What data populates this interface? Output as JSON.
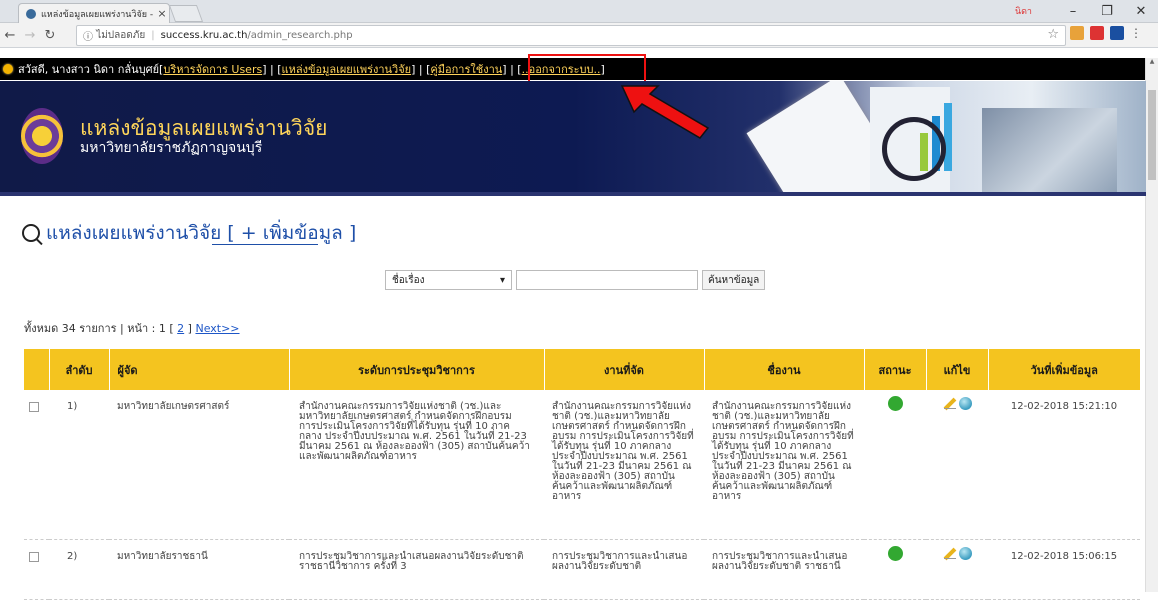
{
  "browser": {
    "tab_title": "แหล่งข้อมูลเผยแพร่งานวิจัย - ",
    "tab_close": "×",
    "window_user": "นิดา",
    "security_label": "ไม่ปลอดภัย",
    "url_host": "success.kru.ac.th",
    "url_path": "/admin_research.php"
  },
  "userbar": {
    "greeting": "สวัสดี, นางสาว นิดา กลั่นบุศย์",
    "sep_open": " [ ",
    "link_users": "บริหารจัดการ Users",
    "sep_mid": " ] | [ ",
    "link_research": "แหล่งข้อมูลเผยแพร่งานวิจัย",
    "sep_mid2": " ] | [ ",
    "link_manual": "คู่มือการใช้งาน",
    "sep_mid3": " ] | [ ",
    "link_logout": "..ออกจากระบบ..",
    "sep_close": " ]"
  },
  "banner": {
    "title": "แหล่งข้อมูลเผยแพร่งานวิจัย",
    "subtitle": "มหาวิทยาลัยราชภัฏกาญจนบุรี"
  },
  "page": {
    "heading": "แหล่งเผยแพร่งานวิจัย",
    "add_link": "[ + เพิ่มข้อมูล ]"
  },
  "search": {
    "field_select": "ชื่อเรื่อง",
    "button": "ค้นหาข้อมูล"
  },
  "pager": {
    "total": "ทั้งหมด 34 รายการ | หน้า : 1 [",
    "page2": "2",
    "close": "] ",
    "next": "Next>>"
  },
  "table": {
    "headers": [
      "ลำดับ",
      "ผู้จัด",
      "ระดับการประชุมวิชาการ",
      "งานที่จัด",
      "ชื่องาน",
      "สถานะ",
      "แก้ไข",
      "วันที่เพิ่มข้อมูล"
    ],
    "rows": [
      {
        "no": "1)",
        "organizer": "มหาวิทยาลัยเกษตรศาสตร์",
        "level": "สำนักงานคณะกรรมการวิจัยแห่งชาติ (วช.)และมหาวิทยาลัยเกษตรศาสตร์ กำหนดจัดการฝึกอบรม การประเมินโครงการวิจัยที่ได้รับทุน รุ่นที่ 10 ภาคกลาง ประจำปีงบประมาณ พ.ศ. 2561 ในวันที่ 21-23 มีนาคม 2561 ณ ห้องละอองฟ้า (305) สถาบันค้นคว้าและพัฒนาผลิตภัณฑ์อาหาร",
        "event": "สำนักงานคณะกรรมการวิจัยแห่งชาติ (วช.)และมหาวิทยาลัยเกษตรศาสตร์ กำหนดจัดการฝึกอบรม การประเมินโครงการวิจัยที่ได้รับทุน รุ่นที่ 10 ภาคกลาง ประจำปีงบประมาณ พ.ศ. 2561 ในวันที่ 21-23 มีนาคม 2561 ณ ห้องละอองฟ้า (305) สถาบันค้นคว้าและพัฒนาผลิตภัณฑ์อาหาร",
        "name": "สำนักงานคณะกรรมการวิจัยแห่งชาติ (วช.)และมหาวิทยาลัยเกษตรศาสตร์ กำหนดจัดการฝึกอบรม การประเมินโครงการวิจัยที่ได้รับทุน รุ่นที่ 10 ภาคกลาง ประจำปีงบประมาณ พ.ศ. 2561 ในวันที่ 21-23 มีนาคม 2561 ณ ห้องละอองฟ้า (305) สถาบันค้นคว้าและพัฒนาผลิตภัณฑ์อาหาร",
        "date": "12-02-2018 15:21:10"
      },
      {
        "no": "2)",
        "organizer": "มหาวิทยาลัยราชธานี",
        "level": "การประชุมวิชาการและนำเสนอผลงานวิจัยระดับชาติ ราชธานีวิชาการ ครั้งที่ 3",
        "event": "การประชุมวิชาการและนำเสนอผลงานวิจัยระดับชาติ",
        "name": "การประชุมวิชาการและนำเสนอผลงานวิจัยระดับชาติ ราชธานี",
        "date": "12-02-2018 15:06:15"
      }
    ]
  },
  "colors": {
    "header_bg": "#f4c41f",
    "link": "#1e4fa8",
    "status_ok": "#32a831",
    "highlight_box": "#e11111"
  },
  "icons": [
    "chrome-favicon",
    "back-icon",
    "forward-icon",
    "reload-icon",
    "info-icon",
    "star-icon",
    "search-icon",
    "status-green-icon",
    "edit-pencil-icon",
    "delete-icon",
    "red-arrow-icon"
  ]
}
